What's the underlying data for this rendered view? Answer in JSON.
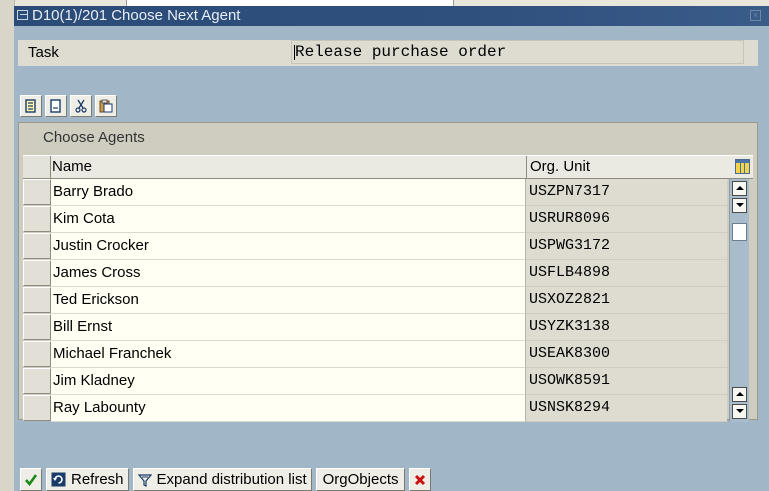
{
  "window": {
    "title": "D10(1)/201 Choose Next Agent"
  },
  "task": {
    "label": "Task",
    "value": "Release purchase order"
  },
  "toolbar": {
    "icons": [
      "details-icon",
      "copy-icon",
      "cut-icon",
      "paste-icon"
    ]
  },
  "agents_panel": {
    "title": "Choose Agents",
    "columns": {
      "name": "Name",
      "org_unit": "Org. Unit"
    },
    "rows": [
      {
        "name": "Barry Brado",
        "org_unit": "USZPN7317"
      },
      {
        "name": "Kim Cota",
        "org_unit": "USRUR8096"
      },
      {
        "name": "Justin Crocker",
        "org_unit": "USPWG3172"
      },
      {
        "name": "James Cross",
        "org_unit": "USFLB4898"
      },
      {
        "name": "Ted Erickson",
        "org_unit": "USXOZ2821"
      },
      {
        "name": "Bill Ernst",
        "org_unit": "USYZK3138"
      },
      {
        "name": "Michael Franchek",
        "org_unit": "USEAK8300"
      },
      {
        "name": "Jim Kladney",
        "org_unit": "USOWK8591"
      },
      {
        "name": "Ray Labounty",
        "org_unit": "USNSK8294"
      }
    ]
  },
  "buttons": {
    "refresh": "Refresh",
    "expand": "Expand distribution list",
    "orgobjects": "OrgObjects"
  },
  "colors": {
    "dialog_bg": "#a1b6c6",
    "titlebar": "#2f4f7d",
    "cancel_red": "#cc1111",
    "confirm_green": "#1b8a1b"
  }
}
